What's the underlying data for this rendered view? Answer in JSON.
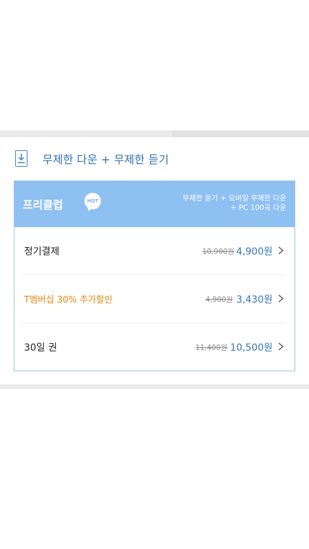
{
  "header": {
    "icon": "download-icon",
    "title": "무제한 다운 + 무제한 듣기"
  },
  "plan": {
    "name": "프리클럽",
    "badge": "HOT",
    "desc_line1": "무제한 듣기 + 모바일 무제한 다운",
    "desc_line2": "+ PC 100곡 다운"
  },
  "options": [
    {
      "label": "정기결제",
      "old_price": "10,900원",
      "price": "4,900원"
    },
    {
      "label": "T멤버십 30% 추가할인",
      "old_price": "4,900원",
      "price": "3,430원"
    },
    {
      "label": "30일 권",
      "old_price": "11,400원",
      "price": "10,500원"
    }
  ],
  "colors": {
    "accent": "#3574b8",
    "header_bg": "#8ec0f2",
    "promo": "#e8870f"
  }
}
